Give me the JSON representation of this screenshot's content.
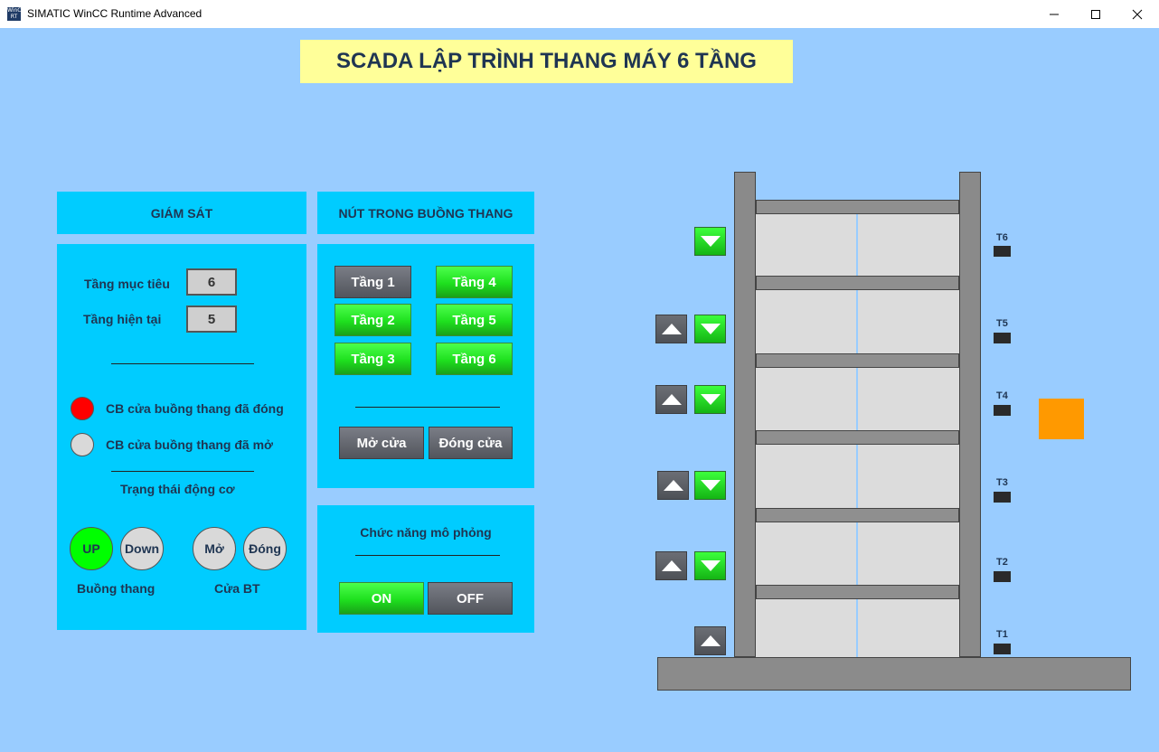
{
  "window": {
    "title": "SIMATIC WinCC Runtime Advanced",
    "logo_text": "WinCC RT",
    "controls": [
      "minimize-icon",
      "maximize-icon",
      "close-icon"
    ]
  },
  "header": {
    "title": "SCADA LẬP TRÌNH THANG MÁY 6 TẦNG"
  },
  "monitor": {
    "header": "GIÁM SÁT",
    "target_floor_label": "Tầng mục tiêu",
    "target_floor_value": "6",
    "current_floor_label": "Tầng hiện tại",
    "current_floor_value": "5",
    "sensor_closed_label": "CB cửa buồng thang đã đóng",
    "sensor_open_label": "CB cửa buồng thang đã mở",
    "motor_status_label": "Trạng thái động cơ",
    "up_label": "UP",
    "down_label": "Down",
    "open_label": "Mở",
    "close_label": "Đóng",
    "cabin_group_label": "Buồng thang",
    "door_group_label": "Cửa BT",
    "colors": {
      "lamp_red": "#ff0000",
      "lamp_off": "#d9d9d9",
      "active_green": "#00ff00"
    }
  },
  "cabin_buttons": {
    "header": "NÚT TRONG BUỒNG THANG",
    "floors": [
      "Tầng 1",
      "Tầng 2",
      "Tầng 3",
      "Tầng 4",
      "Tầng 5",
      "Tầng 6"
    ],
    "open_door": "Mở cửa",
    "close_door": "Đóng cửa"
  },
  "simulation": {
    "header": "Chức năng mô phỏng",
    "on_label": "ON",
    "off_label": "OFF"
  },
  "shaft": {
    "floor_labels": [
      "T6",
      "T5",
      "T4",
      "T3",
      "T2",
      "T1"
    ],
    "call_buttons": [
      "down-arrow-icon",
      "up-arrow-icon",
      "down-arrow-icon",
      "up-arrow-icon",
      "down-arrow-icon",
      "up-arrow-icon",
      "down-arrow-icon",
      "up-arrow-icon",
      "down-arrow-icon",
      "up-arrow-icon"
    ],
    "cabin_color": "#ff9900"
  }
}
